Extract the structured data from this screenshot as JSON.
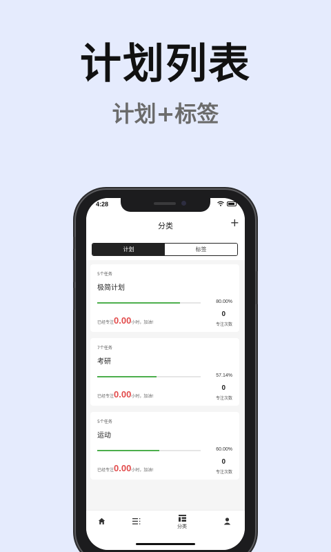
{
  "promo": {
    "title": "计划列表",
    "subtitle": "计划+标签"
  },
  "status_bar": {
    "time": "4:28"
  },
  "navbar": {
    "title": "分类",
    "add_icon": "+"
  },
  "segment": {
    "tabs": [
      "计划",
      "标签"
    ],
    "active": "计划"
  },
  "plans": [
    {
      "task_count": "5个任务",
      "name": "极简计划",
      "progress": 0.8,
      "percent_label": "80.00%",
      "focus_prefix": "已经专注",
      "focus_value": "0.00",
      "focus_suffix": "小时，加油!",
      "count": "0",
      "count_label": "专注次数"
    },
    {
      "task_count": "7个任务",
      "name": "考研",
      "progress": 0.5714,
      "percent_label": "57.14%",
      "focus_prefix": "已经专注",
      "focus_value": "0.00",
      "focus_suffix": "小时，加油!",
      "count": "0",
      "count_label": "专注次数"
    },
    {
      "task_count": "5个任务",
      "name": "运动",
      "progress": 0.6,
      "percent_label": "60.00%",
      "focus_prefix": "已经专注",
      "focus_value": "0.00",
      "focus_suffix": "小时，加油!",
      "count": "0",
      "count_label": "专注次数"
    }
  ],
  "tabbar": {
    "items": [
      {
        "icon": "home-icon",
        "label": ""
      },
      {
        "icon": "list-icon",
        "label": ""
      },
      {
        "icon": "category-icon",
        "label": "分类"
      },
      {
        "icon": "profile-icon",
        "label": ""
      }
    ]
  },
  "colors": {
    "background": "#e5ebfd",
    "progress": "#4cae4c",
    "focus_value": "#e24b4b",
    "segment_active": "#222222"
  }
}
